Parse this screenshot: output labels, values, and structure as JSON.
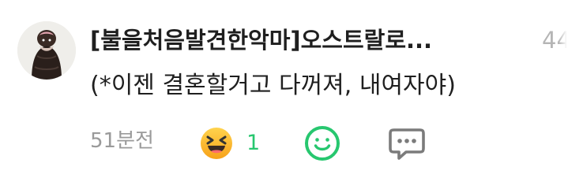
{
  "comment": {
    "username": "[불을처음발견한악마]오스트랄로...",
    "side_count": "44",
    "text": "(*이젠 결혼할거고 다꺼져, 내여자야)",
    "timestamp": "51분전"
  },
  "reactions": {
    "laugh": {
      "icon": "laughing-emoji-icon",
      "count": "1"
    },
    "add_reaction_icon": "smiley-outline-icon",
    "reply_icon": "speech-bubble-icon"
  },
  "colors": {
    "username": "#1f1f1f",
    "text": "#1f1f1f",
    "meta": "#9a9a9a",
    "accent_green": "#27c76f",
    "icon_gray": "#7b7b7b"
  }
}
